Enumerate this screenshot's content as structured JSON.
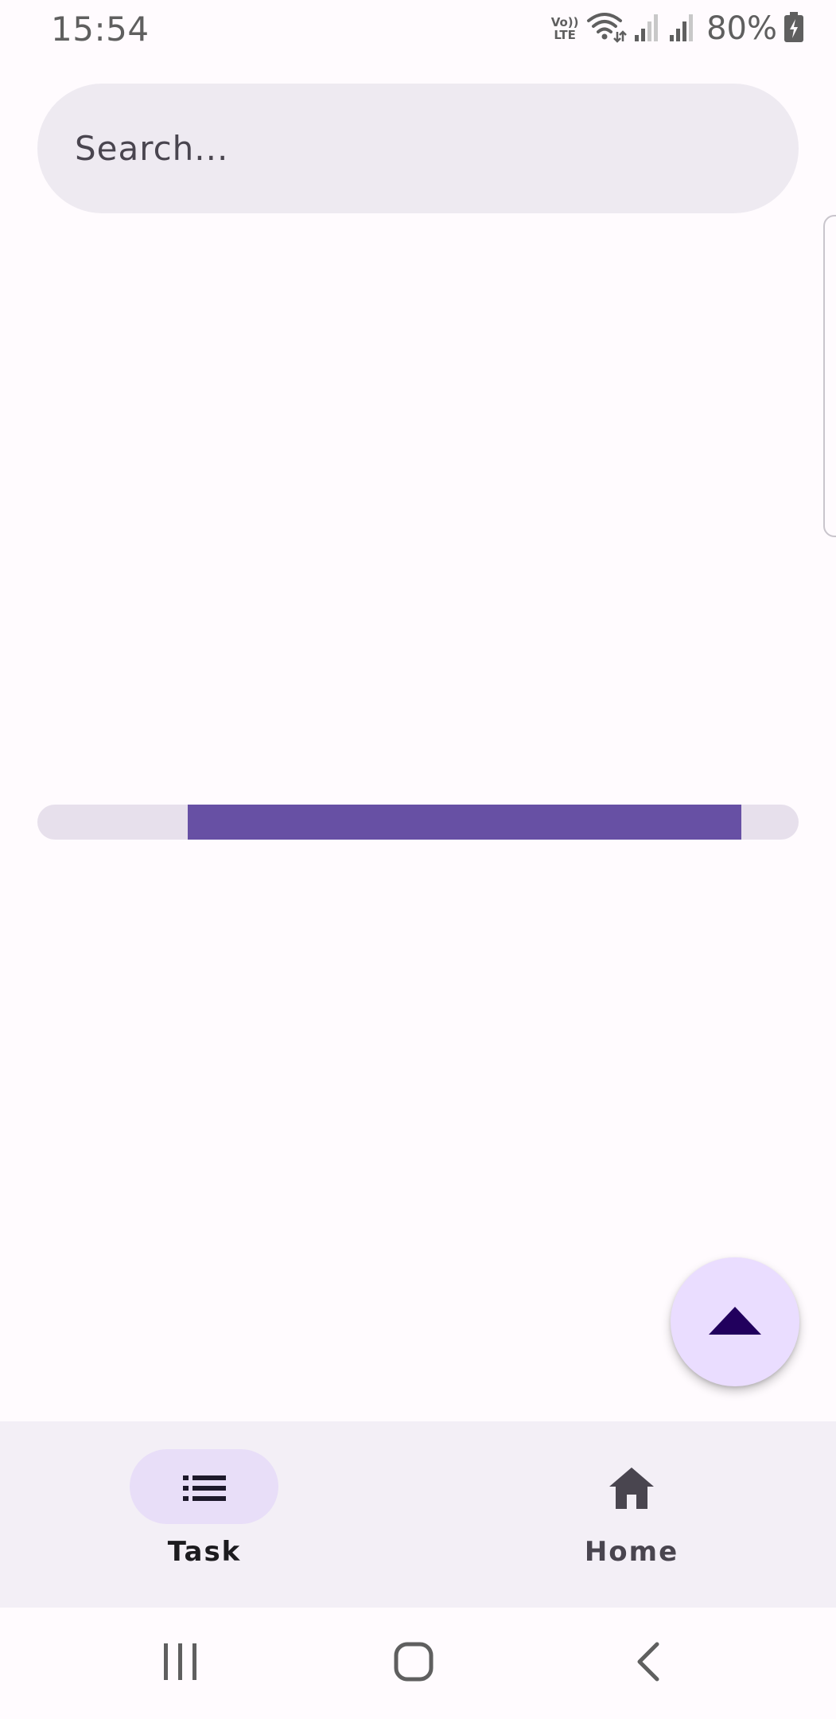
{
  "status_bar": {
    "time": "15:54",
    "volte_line1": "Vo))",
    "volte_line2": "LTE",
    "battery_percent": "80%"
  },
  "search": {
    "placeholder": "Search..."
  },
  "progress": {
    "start_fraction": 0.198,
    "end_fraction": 0.925,
    "indicator_color": "#6750A4",
    "track_color": "#E7E0EC"
  },
  "fab": {
    "icon": "arrow-drop-up-icon",
    "color": "#EADDFF"
  },
  "bottom_nav": {
    "items": [
      {
        "label": "Task",
        "icon": "list-icon",
        "selected": true
      },
      {
        "label": "Home",
        "icon": "home-icon",
        "selected": false
      }
    ]
  },
  "system_nav": {
    "buttons": [
      "recents-icon",
      "home-circle-icon",
      "back-chevron-icon"
    ]
  },
  "colors": {
    "background": "#FFFBFE",
    "search_bg": "#EEEAF1",
    "nav_bg": "#F3EFF6",
    "nav_active_indicator": "#E8DEF8",
    "fab_icon": "#21005D"
  }
}
